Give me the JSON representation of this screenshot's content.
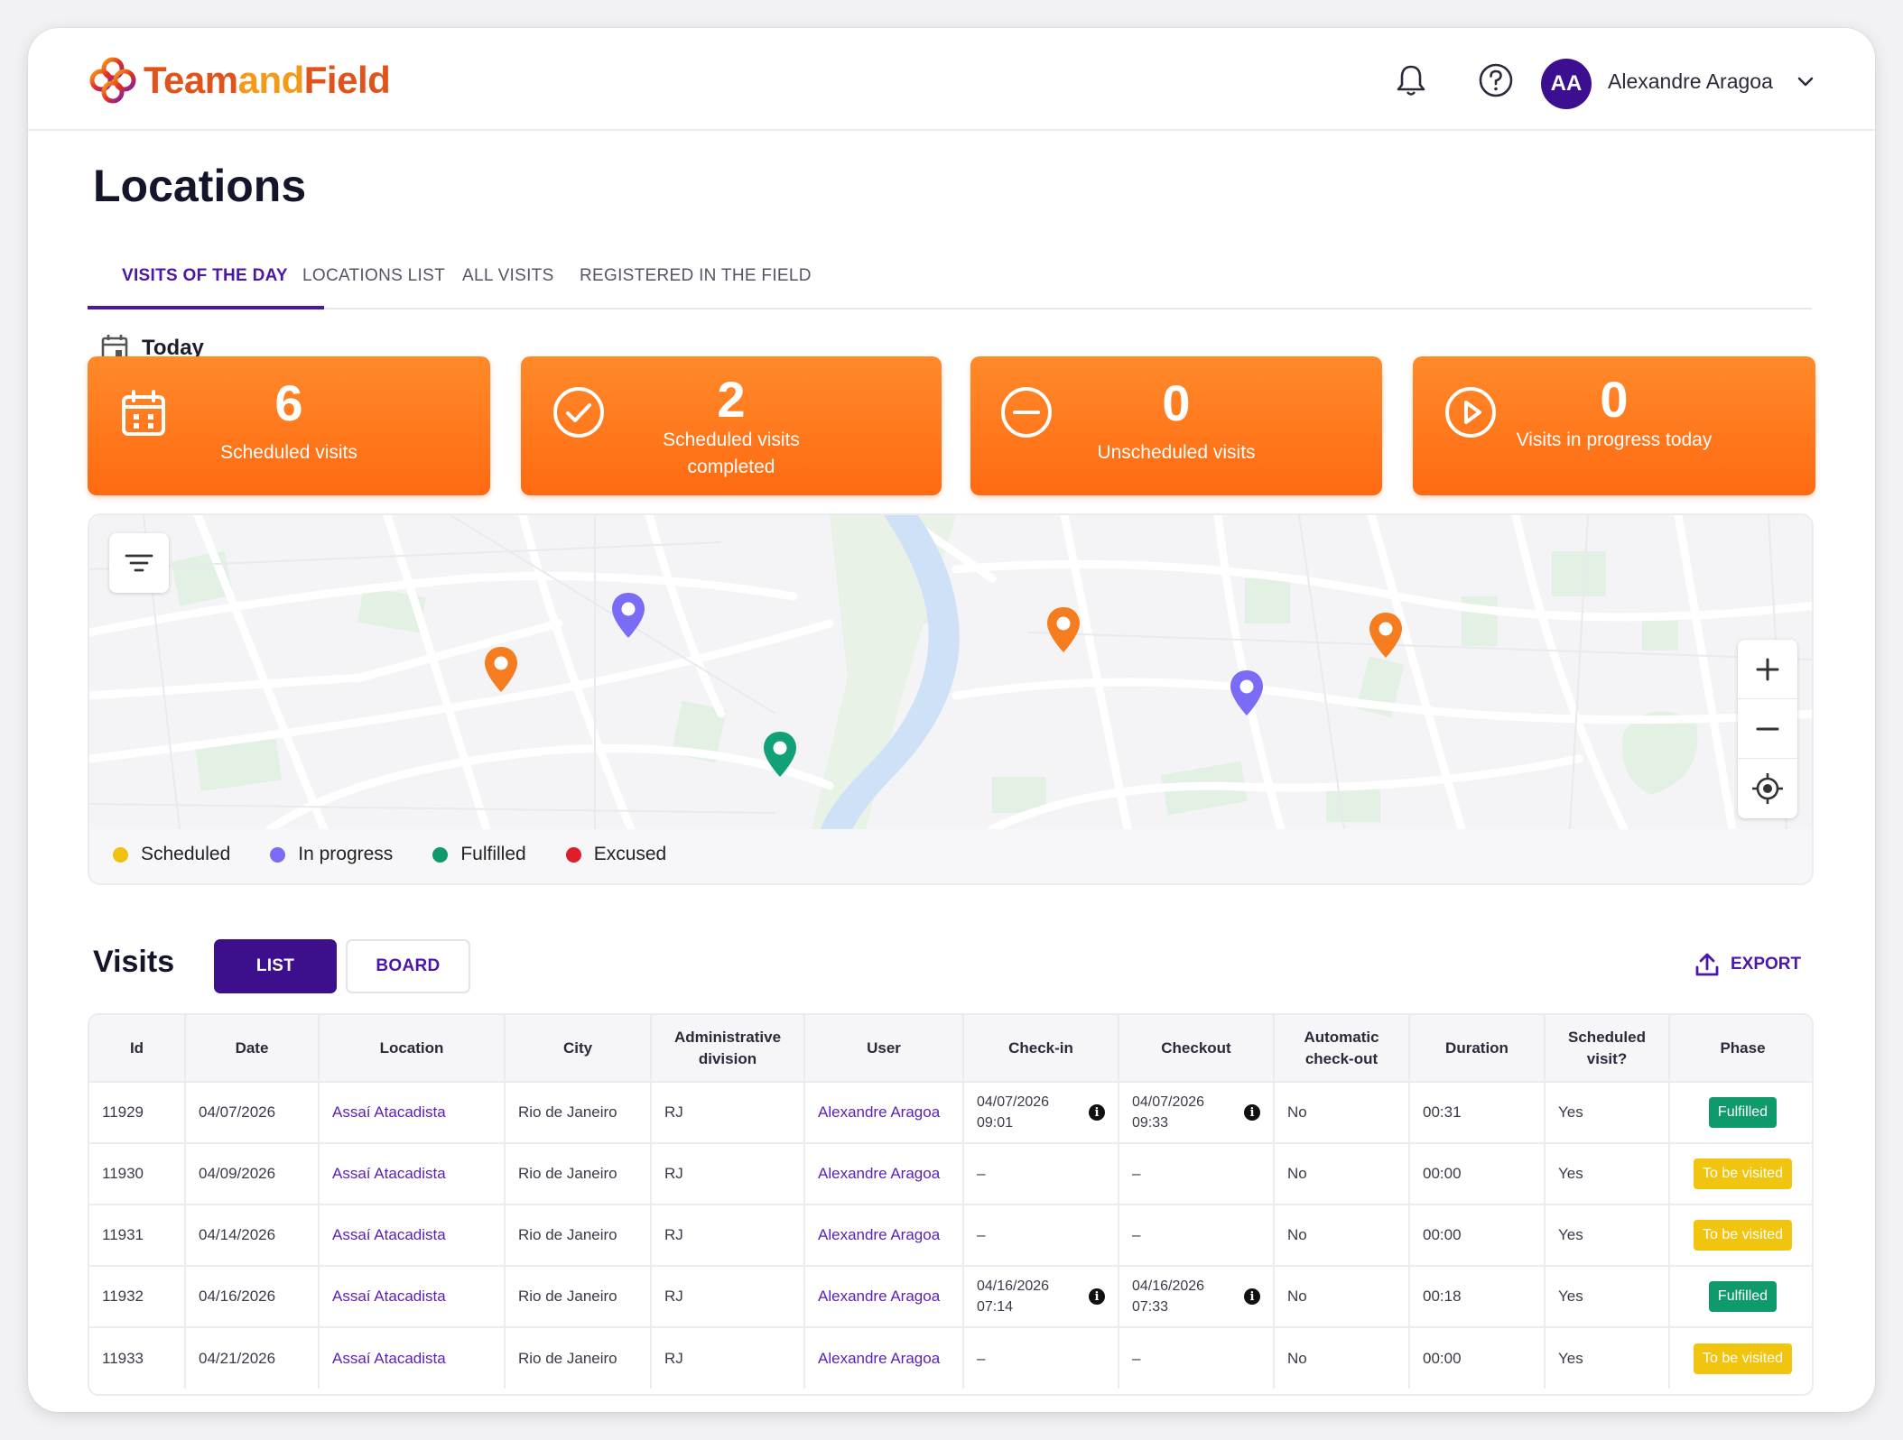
{
  "header": {
    "logo_text_a": "Team",
    "logo_text_b": "and",
    "logo_text_c": "Field",
    "avatar_initials": "AA",
    "user_name": "Alexandre Aragoa"
  },
  "page": {
    "title": "Locations"
  },
  "tabs": [
    {
      "label": "VISITS OF THE DAY",
      "active": true
    },
    {
      "label": "LOCATIONS LIST",
      "active": false
    },
    {
      "label": "ALL VISITS",
      "active": false
    },
    {
      "label": "REGISTERED IN THE FIELD",
      "active": false
    }
  ],
  "date_filter": {
    "label": "Today"
  },
  "stats": [
    {
      "value": "6",
      "label": "Scheduled visits",
      "icon": "calendar-icon"
    },
    {
      "value": "2",
      "label": "Scheduled visits completed",
      "icon": "check-circle-icon"
    },
    {
      "value": "0",
      "label": "Unscheduled visits",
      "icon": "minus-circle-icon"
    },
    {
      "value": "0",
      "label": "Visits in progress today",
      "icon": "play-circle-icon"
    }
  ],
  "map": {
    "legend": [
      {
        "label": "Scheduled",
        "color": "#f2c00f"
      },
      {
        "label": "In progress",
        "color": "#7b6cf6"
      },
      {
        "label": "Fulfilled",
        "color": "#0f9a6b"
      },
      {
        "label": "Excused",
        "color": "#e01e2a"
      }
    ],
    "pin_colors": {
      "orange": "#f57c1f",
      "purple": "#7b6cf6",
      "green": "#12a079"
    }
  },
  "visits": {
    "title": "Visits",
    "view_list": "LIST",
    "view_board": "BOARD",
    "export_label": "EXPORT",
    "columns": [
      "Id",
      "Date",
      "Location",
      "City",
      "Administrative division",
      "User",
      "Check-in",
      "Checkout",
      "Automatic check-out",
      "Duration",
      "Scheduled visit?",
      "Phase"
    ],
    "rows": [
      {
        "id": "11929",
        "date": "04/07/2026",
        "location": "Assaí Atacadista",
        "city": "Rio de Janeiro",
        "division": "RJ",
        "user": "Alexandre Aragoa",
        "checkin_date": "04/07/2026",
        "checkin_time": "09:01",
        "checkout_date": "04/07/2026",
        "checkout_time": "09:33",
        "auto_checkout": "No",
        "duration": "00:31",
        "scheduled": "Yes",
        "phase": "Fulfilled"
      },
      {
        "id": "11930",
        "date": "04/09/2026",
        "location": "Assaí Atacadista",
        "city": "Rio de Janeiro",
        "division": "RJ",
        "user": "Alexandre Aragoa",
        "checkin": "–",
        "checkout": "–",
        "auto_checkout": "No",
        "duration": "00:00",
        "scheduled": "Yes",
        "phase": "To be visited"
      },
      {
        "id": "11931",
        "date": "04/14/2026",
        "location": "Assaí Atacadista",
        "city": "Rio de Janeiro",
        "division": "RJ",
        "user": "Alexandre Aragoa",
        "checkin": "–",
        "checkout": "–",
        "auto_checkout": "No",
        "duration": "00:00",
        "scheduled": "Yes",
        "phase": "To be visited"
      },
      {
        "id": "11932",
        "date": "04/16/2026",
        "location": "Assaí Atacadista",
        "city": "Rio de Janeiro",
        "division": "RJ",
        "user": "Alexandre Aragoa",
        "checkin_date": "04/16/2026",
        "checkin_time": "07:14",
        "checkout_date": "04/16/2026",
        "checkout_time": "07:33",
        "auto_checkout": "No",
        "duration": "00:18",
        "scheduled": "Yes",
        "phase": "Fulfilled"
      },
      {
        "id": "11933",
        "date": "04/21/2026",
        "location": "Assaí Atacadista",
        "city": "Rio de Janeiro",
        "division": "RJ",
        "user": "Alexandre Aragoa",
        "checkin": "–",
        "checkout": "–",
        "auto_checkout": "No",
        "duration": "00:00",
        "scheduled": "Yes",
        "phase": "To be visited"
      }
    ]
  }
}
